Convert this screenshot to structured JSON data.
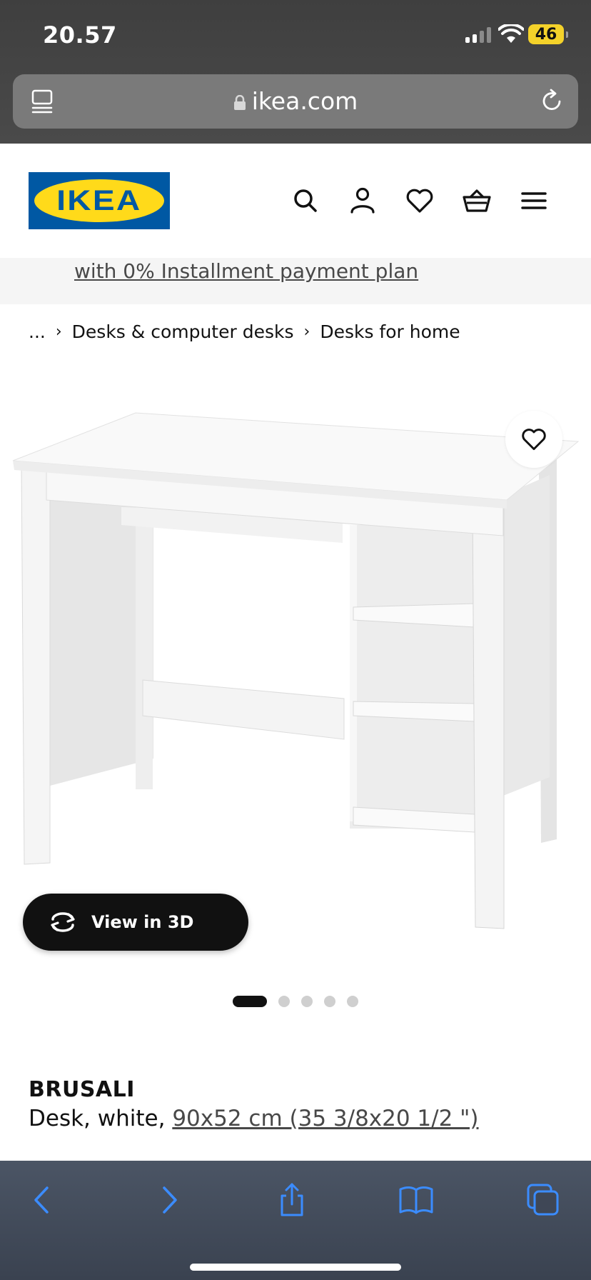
{
  "status_bar": {
    "time": "20.57",
    "battery": "46"
  },
  "browser": {
    "url": "ikea.com"
  },
  "header": {
    "logo_text": "IKEA",
    "brand_blue": "#0058a3",
    "brand_yellow": "#ffda1a"
  },
  "promo": {
    "link_text": "with 0% Installment payment plan"
  },
  "breadcrumb": {
    "ellipsis": "...",
    "items": [
      "Desks & computer desks",
      "Desks for home"
    ]
  },
  "gallery": {
    "view3d_label": "View in 3D",
    "image_count": 5,
    "active_index": 0
  },
  "product": {
    "name": "BRUSALI",
    "description_prefix": "Desk, white, ",
    "size_link": "90x52 cm (35 3/8x20 1/2 \")"
  },
  "toolbar": {
    "icons": [
      "back-icon",
      "forward-icon",
      "share-icon",
      "bookmarks-icon",
      "tabs-icon"
    ],
    "accent": "#3b8cff"
  }
}
